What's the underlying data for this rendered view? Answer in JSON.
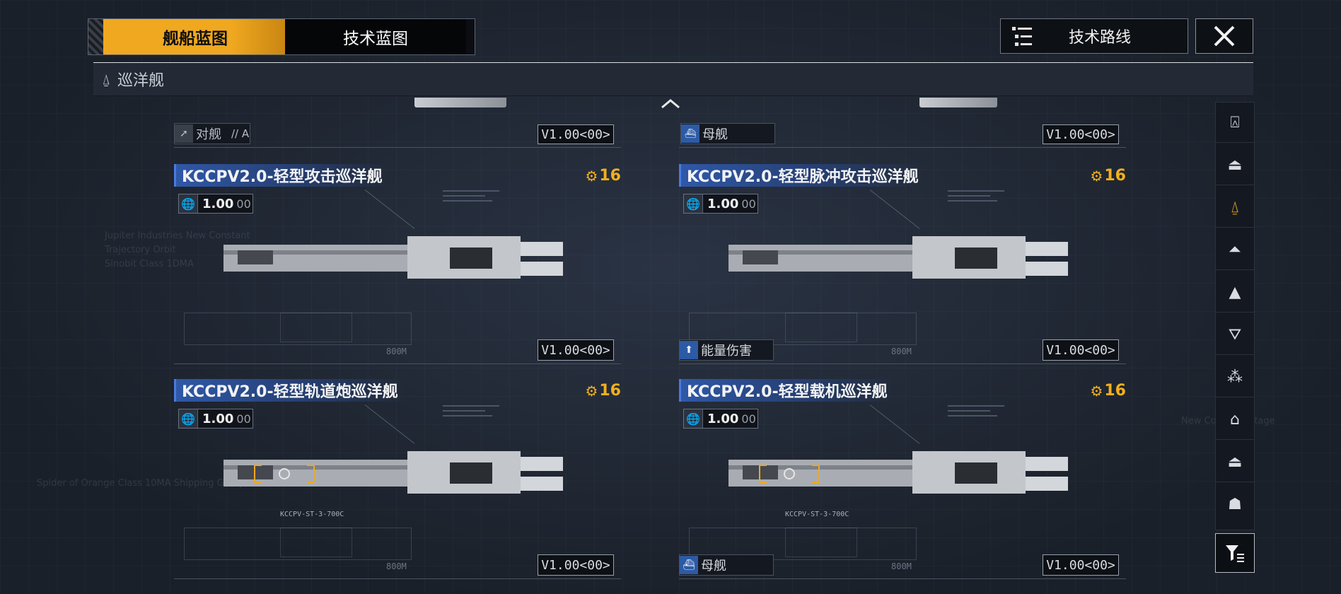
{
  "tabs": [
    {
      "label": "舰船蓝图",
      "active": true
    },
    {
      "label": "技术蓝图",
      "active": false
    }
  ],
  "tech_route": {
    "label": "技术路线"
  },
  "category": {
    "label": "巡洋舰"
  },
  "partial_row": [
    {
      "badge": "对舰",
      "badge_suffix": "// A",
      "model": "V1.00<00>"
    },
    {
      "badge": "母舰",
      "model": "V1.00<00>"
    }
  ],
  "cards": [
    {
      "name": "KCCPV2.0-轻型攻击巡洋舰",
      "cost": "16",
      "version": "1.00",
      "version_sub": "00",
      "model": "V1.00<00>",
      "blueprint_label": ""
    },
    {
      "name": "KCCPV2.0-轻型脉冲攻击巡洋舰",
      "cost": "16",
      "version": "1.00",
      "version_sub": "00",
      "model": "V1.00<00>",
      "blueprint_label": "能量伤害"
    },
    {
      "name": "KCCPV2.0-轻型轨道炮巡洋舰",
      "cost": "16",
      "version": "1.00",
      "version_sub": "00",
      "model": "V1.00<00>",
      "blueprint_label": "",
      "part_tag": "KCCPV-ST-3-700C"
    },
    {
      "name": "KCCPV2.0-轻型载机巡洋舰",
      "cost": "16",
      "version": "1.00",
      "version_sub": "00",
      "model": "V1.00<00>",
      "blueprint_label": "母舰",
      "part_tag": "KCCPV-ST-3-700C"
    }
  ],
  "length_label": "800M",
  "sidebar": {
    "items": [
      "battleship-icon",
      "carrier-icon",
      "cruiser-icon",
      "destroyer-icon",
      "frigate-icon",
      "corvette-icon",
      "fighter-icon",
      "hangar-icon",
      "dome-icon",
      "shelter-icon"
    ],
    "active_index": 2
  },
  "colors": {
    "accent": "#f0a820",
    "name_bar": "#2f58a8",
    "background": "#1c2330"
  }
}
